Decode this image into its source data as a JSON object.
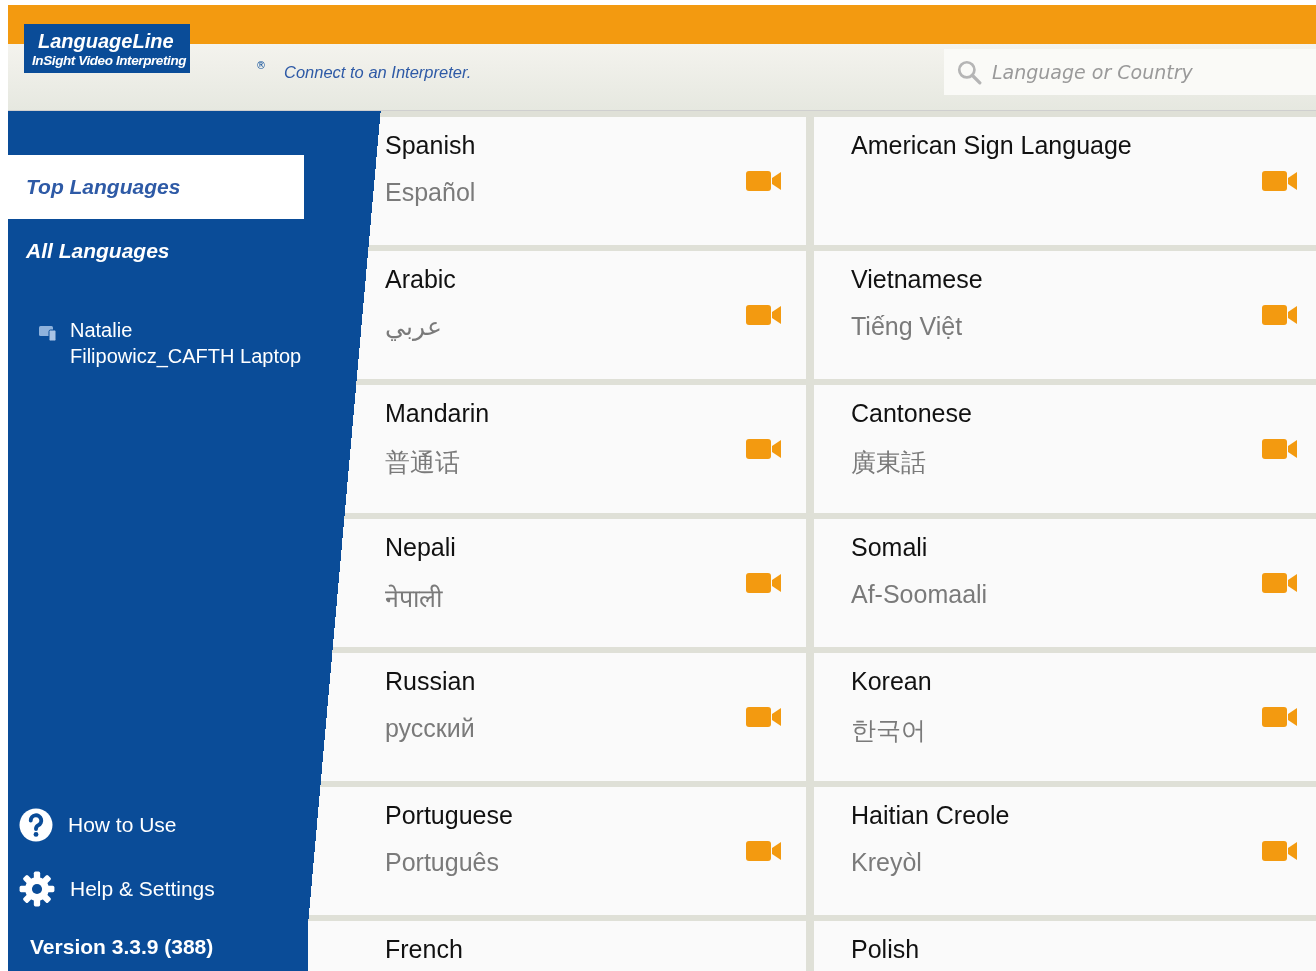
{
  "header": {
    "logo_title": "LanguageLine",
    "logo_subtitle": "InSight Video Interpreting",
    "registered_mark": "®",
    "tagline": "Connect to an Interpreter.",
    "search": {
      "placeholder": "Language or Country"
    }
  },
  "sidebar": {
    "items": [
      {
        "label": "Top Languages",
        "selected": true
      },
      {
        "label": "All Languages",
        "selected": false
      }
    ],
    "device": {
      "name": "Natalie Filipowicz_CAFTH Laptop"
    },
    "footer_items": [
      {
        "kind": "help",
        "label": "How to Use"
      },
      {
        "kind": "settings",
        "label": "Help & Settings"
      }
    ],
    "version": "Version 3.3.9 (388)"
  },
  "languages": [
    {
      "name": "Spanish",
      "native": "Español"
    },
    {
      "name": "American Sign Language"
    },
    {
      "name": "Arabic",
      "native": "عربي"
    },
    {
      "name": "Vietnamese",
      "native": "Tiếng Việt"
    },
    {
      "name": "Mandarin",
      "native": "普通话"
    },
    {
      "name": "Cantonese",
      "native": "廣東話"
    },
    {
      "name": "Nepali",
      "native": "नेपाली"
    },
    {
      "name": "Somali",
      "native": "Af-Soomaali"
    },
    {
      "name": "Russian",
      "native": "русский"
    },
    {
      "name": "Korean",
      "native": "한국어"
    },
    {
      "name": "Portuguese",
      "native": "Português"
    },
    {
      "name": "Haitian Creole",
      "native": "Kreyòl"
    },
    {
      "name": "French"
    },
    {
      "name": "Polish"
    }
  ]
}
